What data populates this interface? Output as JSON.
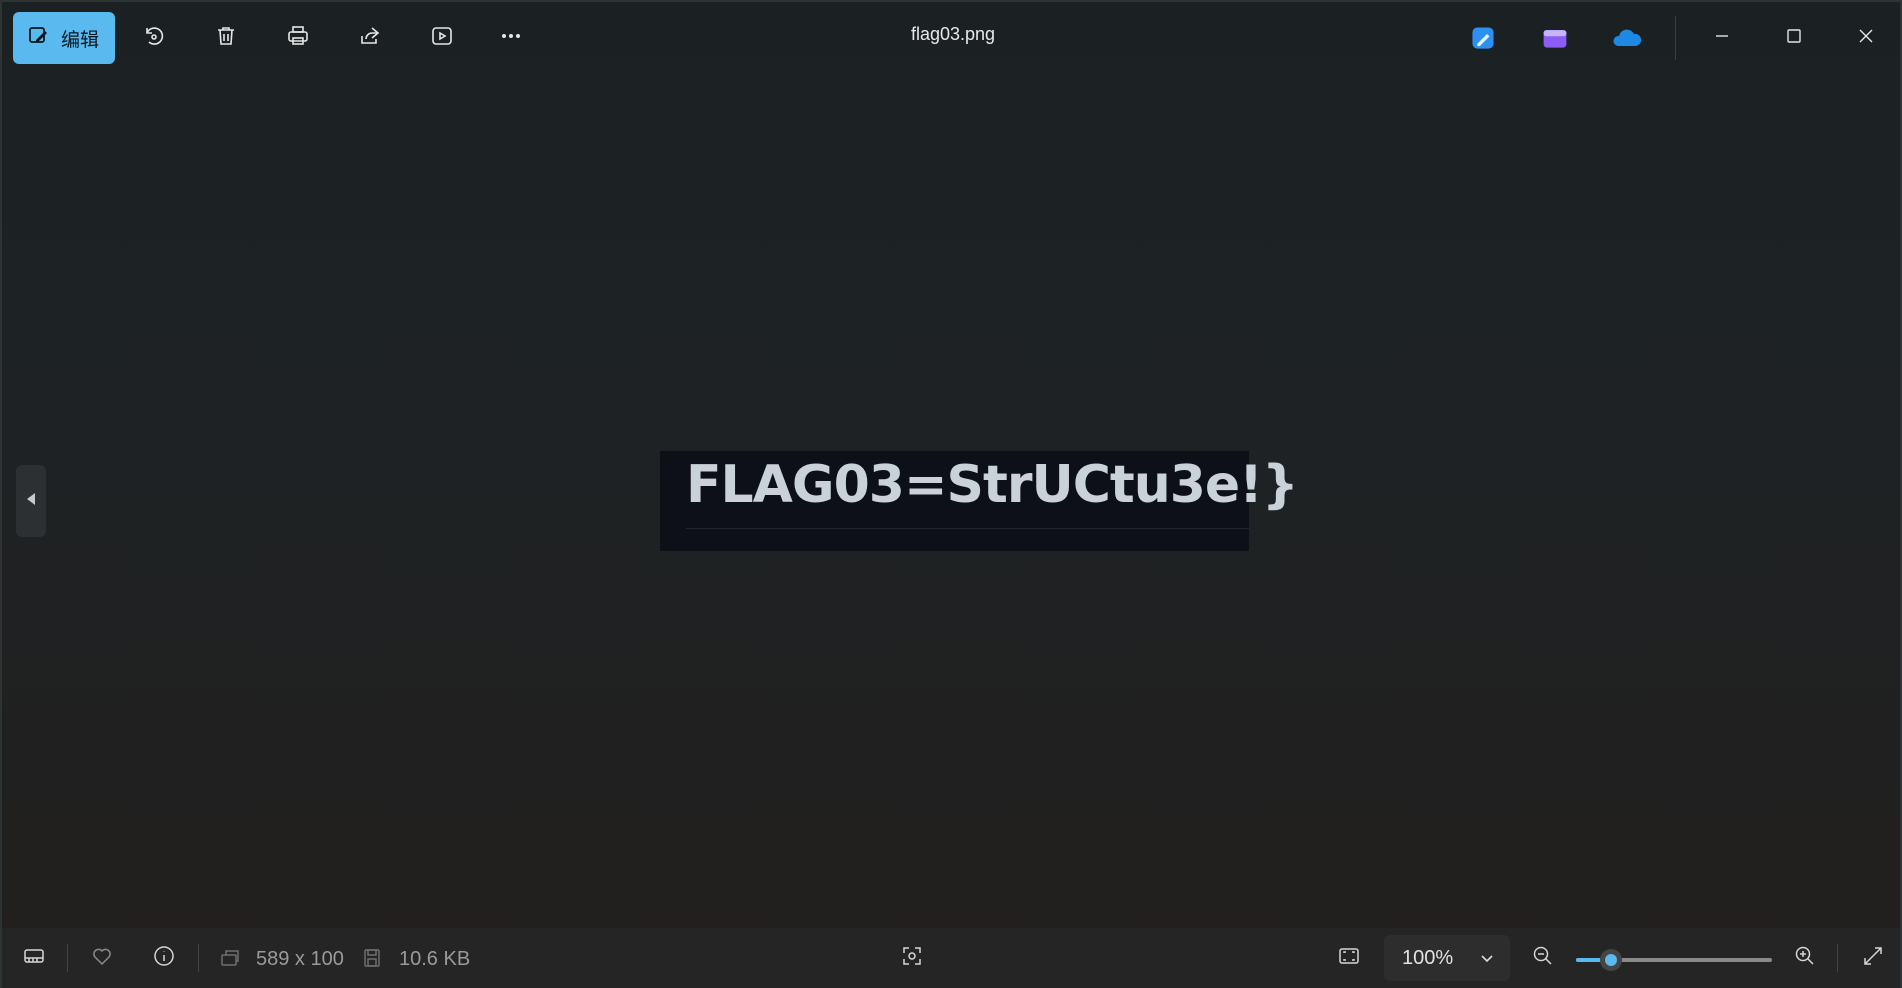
{
  "window": {
    "title": "flag03.png"
  },
  "toolbar": {
    "edit_label": "编辑",
    "buttons": [
      {
        "name": "rotate",
        "icon": "rotate-icon"
      },
      {
        "name": "delete",
        "icon": "trash-icon"
      },
      {
        "name": "print",
        "icon": "printer-icon"
      },
      {
        "name": "share",
        "icon": "share-icon"
      },
      {
        "name": "slideshow",
        "icon": "play-icon"
      },
      {
        "name": "more",
        "icon": "more-icon"
      }
    ],
    "apps": [
      "designer-app-icon",
      "clipchamp-app-icon",
      "onedrive-icon"
    ]
  },
  "image": {
    "text": "FLAG03=StrUCtu3e!}"
  },
  "status": {
    "dimensions": "589 x 100",
    "file_size": "10.6 KB",
    "zoom": "100%",
    "zoom_level": 0.18
  },
  "colors": {
    "accent": "#5ab9ee",
    "background": "#1e2224"
  }
}
